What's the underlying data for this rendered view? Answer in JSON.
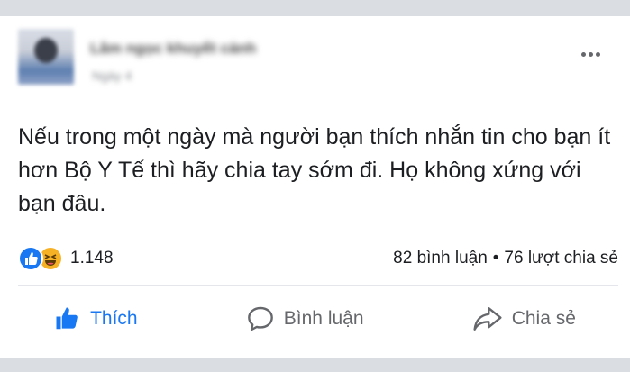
{
  "post": {
    "author_name": "Lâm ngọc khuyết cảnh",
    "time": "Ngày 4",
    "text": "Nếu trong một ngày mà người bạn thích nhắn tin cho bạn ít hơn Bộ Y Tế thì hãy chia tay sớm đi. Họ không xứng với bạn đâu.",
    "reaction_count": "1.148",
    "comments_label": "82 bình luận",
    "separator": "•",
    "shares_label": "76 lượt chia sẻ"
  },
  "actions": {
    "like_label": "Thích",
    "comment_label": "Bình luận",
    "share_label": "Chia sẻ"
  },
  "colors": {
    "like_blue": "#1877f2",
    "haha_yellow": "#f7b125",
    "muted_gray": "#65676b"
  },
  "icons": [
    "more-options-icon",
    "like-reaction-icon",
    "haha-reaction-icon",
    "thumbs-up-icon",
    "comment-bubble-icon",
    "share-arrow-icon"
  ]
}
